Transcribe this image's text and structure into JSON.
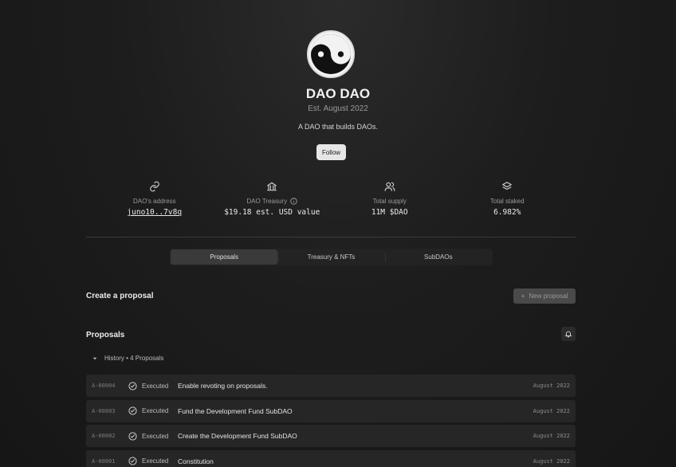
{
  "header": {
    "name": "DAO DAO",
    "established": "Est. August 2022",
    "description": "A DAO that builds DAOs.",
    "follow_label": "Follow"
  },
  "stats": [
    {
      "icon": "link-icon",
      "label": "DAO's address",
      "value": "juno10..7v8q"
    },
    {
      "icon": "bank-icon",
      "label": "DAO Treasury",
      "value": "$19.18 est. USD value"
    },
    {
      "icon": "users-icon",
      "label": "Total supply",
      "value": "11M $DAO"
    },
    {
      "icon": "layers-icon",
      "label": "Total staked",
      "value": "6.982%"
    }
  ],
  "tabs": [
    {
      "label": "Proposals",
      "active": true
    },
    {
      "label": "Treasury & NFTs",
      "active": false
    },
    {
      "label": "SubDAOs",
      "active": false
    }
  ],
  "create": {
    "title": "Create a proposal",
    "new_button_label": "New proposal"
  },
  "proposals": {
    "title": "Proposals",
    "history_label": "History • 4 Proposals",
    "items": [
      {
        "id": "A-00004",
        "status": "Executed",
        "title": "Enable revoting on proposals.",
        "date": "August 2022"
      },
      {
        "id": "A-00003",
        "status": "Executed",
        "title": "Fund the Development Fund SubDAO",
        "date": "August 2022"
      },
      {
        "id": "A-00002",
        "status": "Executed",
        "title": "Create the Development Fund SubDAO",
        "date": "August 2022"
      },
      {
        "id": "A-00001",
        "status": "Executed",
        "title": "Constitution",
        "date": "August 2022"
      }
    ]
  }
}
